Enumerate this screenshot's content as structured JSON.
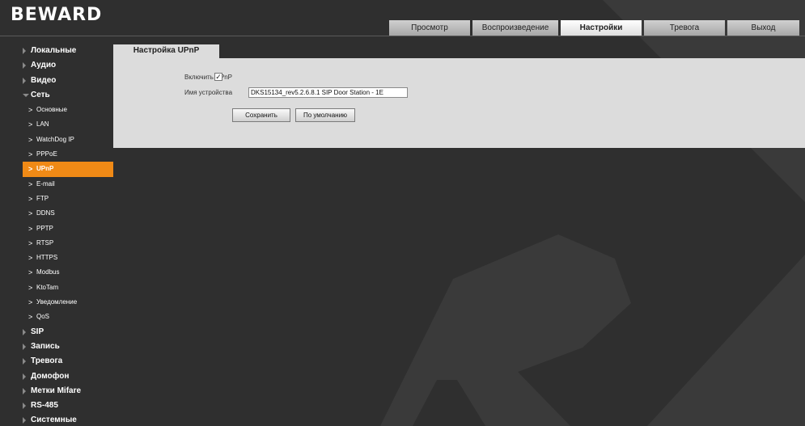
{
  "header": {
    "logo": "BEWARD",
    "tabs": [
      {
        "label": "Просмотр",
        "active": false
      },
      {
        "label": "Воспроизведение",
        "active": false
      },
      {
        "label": "Настройки",
        "active": true
      },
      {
        "label": "Тревога",
        "active": false
      },
      {
        "label": "Выход",
        "active": false
      }
    ]
  },
  "sidebar": {
    "items": [
      {
        "label": "Локальные"
      },
      {
        "label": "Аудио"
      },
      {
        "label": "Видео"
      },
      {
        "label": "Сеть",
        "open": true,
        "children": [
          {
            "label": "Основные"
          },
          {
            "label": "LAN"
          },
          {
            "label": "WatchDog IP"
          },
          {
            "label": "PPPoE"
          },
          {
            "label": "UPnP",
            "active": true
          },
          {
            "label": "E-mail"
          },
          {
            "label": "FTP"
          },
          {
            "label": "DDNS"
          },
          {
            "label": "PPTP"
          },
          {
            "label": "RTSP"
          },
          {
            "label": "HTTPS"
          },
          {
            "label": "Modbus"
          },
          {
            "label": "KtoTam"
          },
          {
            "label": "Уведомление"
          },
          {
            "label": "QoS"
          }
        ]
      },
      {
        "label": "SIP"
      },
      {
        "label": "Запись"
      },
      {
        "label": "Тревога"
      },
      {
        "label": "Домофон"
      },
      {
        "label": "Метки Mifare"
      },
      {
        "label": "RS-485"
      },
      {
        "label": "Системные"
      }
    ]
  },
  "panel": {
    "title": "Настройка UPnP",
    "enable_label": "Включить UPnP",
    "enable_checked": true,
    "check_glyph": "✓",
    "device_label": "Имя устройства",
    "device_value": "DKS15134_rev5.2.6.8.1 SIP Door Station - 1E",
    "save_label": "Сохранить",
    "default_label": "По умолчанию"
  },
  "colors": {
    "background": "#2f2f2f",
    "panel": "#dcdcdc",
    "accent": "#f08a16"
  }
}
